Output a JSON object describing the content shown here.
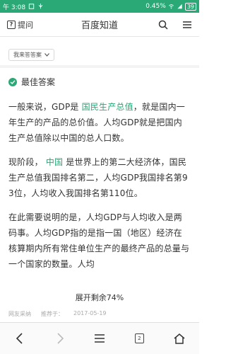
{
  "status_bar": {
    "carrier": "□",
    "time": "午 3:08",
    "speed": "0.45%",
    "battery": "39"
  },
  "top_nav": {
    "ask_label": "提问",
    "title": "百度知道"
  },
  "my_answer": {
    "label": "我来答答案"
  },
  "best_answer": {
    "title": "最佳答案"
  },
  "answer": {
    "p1_a": "一般来说，GDP是 ",
    "p1_link": "国民生产总值",
    "p1_b": "，就是国内一年生产的产品的总价值。人均GDP就是把国内生产总值除以中国的总人口数。",
    "p2_a": "现阶段， ",
    "p2_link": "中国",
    "p2_b": " 是世界上的第二大经济体，国民生产总值我国排名第二，人均GDP我国排名第93位，人均收入我国排名第110位。",
    "p3": "在此需要说明的是，人均GDP与人均收入是两码事。人均GDP指的是指一国（地区）经济在核算期内所有常住单位生产的最终产品的总量与一个国家的数量。人均"
  },
  "expand": {
    "label": "展开剩余74%",
    "remaining_percent": 74
  },
  "meta": {
    "source": "网友采纳",
    "recommender": "推荐于：",
    "date": "2017-05-19"
  },
  "bottom_bar": {
    "tab_count": "2"
  },
  "colors": {
    "accent": "#2aa876",
    "text": "#333333"
  }
}
